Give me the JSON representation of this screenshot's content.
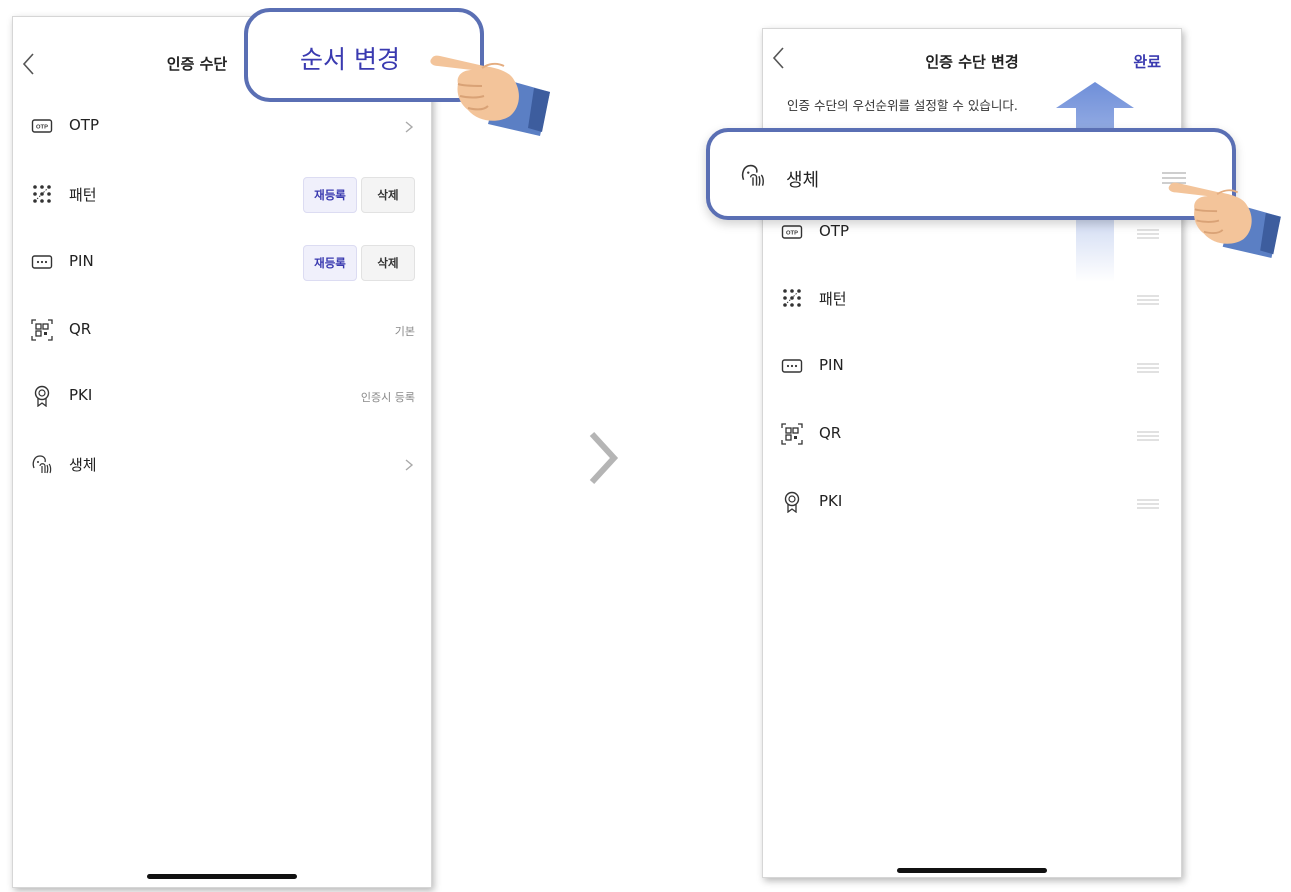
{
  "left_screen": {
    "title": "인증 수단",
    "items": [
      {
        "icon": "otp-icon",
        "label": "OTP",
        "action": "chevron"
      },
      {
        "icon": "pattern-icon",
        "label": "패턴",
        "rereg": "재등록",
        "del": "삭제"
      },
      {
        "icon": "pin-icon",
        "label": "PIN",
        "rereg": "재등록",
        "del": "삭제"
      },
      {
        "icon": "qr-icon",
        "label": "QR",
        "note": "기본"
      },
      {
        "icon": "pki-icon",
        "label": "PKI",
        "note": "인증시 등록"
      },
      {
        "icon": "biometric-icon",
        "label": "생체",
        "action": "chevron"
      }
    ]
  },
  "callout_left": {
    "text": "순서 변경"
  },
  "right_screen": {
    "title": "인증 수단 변경",
    "done_label": "완료",
    "subtitle": "인증 수단의 우선순위를 설정할 수 있습니다.",
    "items": [
      {
        "icon": "otp-icon",
        "label": "OTP"
      },
      {
        "icon": "pattern-icon",
        "label": "패턴"
      },
      {
        "icon": "pin-icon",
        "label": "PIN"
      },
      {
        "icon": "qr-icon",
        "label": "QR"
      },
      {
        "icon": "pki-icon",
        "label": "PKI"
      }
    ]
  },
  "highlight_right": {
    "icon": "biometric-icon",
    "label": "생체"
  },
  "colors": {
    "accent": "#3a3ab0",
    "callout_border": "#5a6fb4",
    "arrow": "#6f8fd9"
  }
}
